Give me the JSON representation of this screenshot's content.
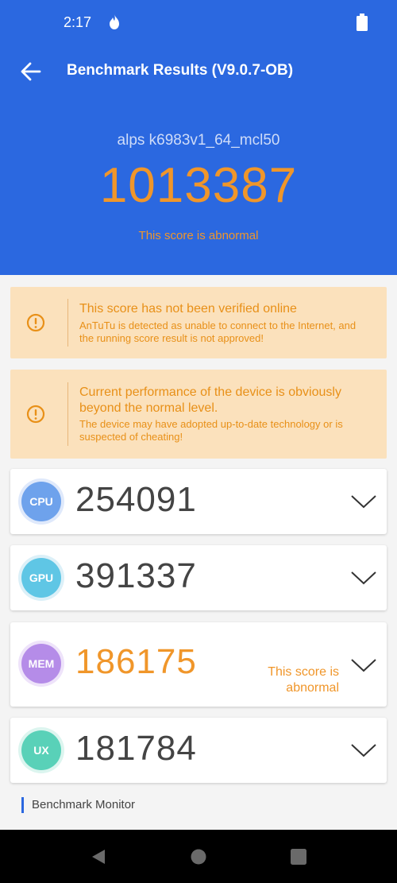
{
  "status_bar": {
    "time": "2:17"
  },
  "toolbar": {
    "title": "Benchmark Results (V9.0.7-OB)"
  },
  "summary": {
    "device": "alps k6983v1_64_mcl50",
    "total_score": "1013387",
    "score_note": "This score is abnormal"
  },
  "warnings": [
    {
      "title": "This score has not been verified online",
      "detail": "AnTuTu is detected as unable to connect to the Internet, and the running score result is not approved!"
    },
    {
      "title": "Current performance of the device is obviously beyond the normal level.",
      "detail": "The device may have adopted up-to-date technology or is suspected of cheating!"
    }
  ],
  "scores": [
    {
      "badge": "CPU",
      "value": "254091"
    },
    {
      "badge": "GPU",
      "value": "391337"
    },
    {
      "badge": "MEM",
      "value": "186175",
      "note": "This score is abnormal"
    },
    {
      "badge": "UX",
      "value": "181784"
    }
  ],
  "footer": {
    "monitor_label": "Benchmark Monitor"
  },
  "icons": {
    "status": [
      "flame-icon",
      "battery-icon"
    ],
    "toolbar": "back-arrow-icon",
    "warning": "alert-circle-icon",
    "expand": "chevron-down-icon",
    "nav": [
      "nav-back-icon",
      "nav-home-icon",
      "nav-recents-icon"
    ]
  },
  "colors": {
    "header_bg": "#2b68e0",
    "accent_orange": "#f0962a",
    "warning_bg": "#fbe1bc",
    "cpu": "#6ea2ec",
    "gpu": "#5fc6e5",
    "mem": "#b58ce8",
    "ux": "#59d1b8"
  }
}
